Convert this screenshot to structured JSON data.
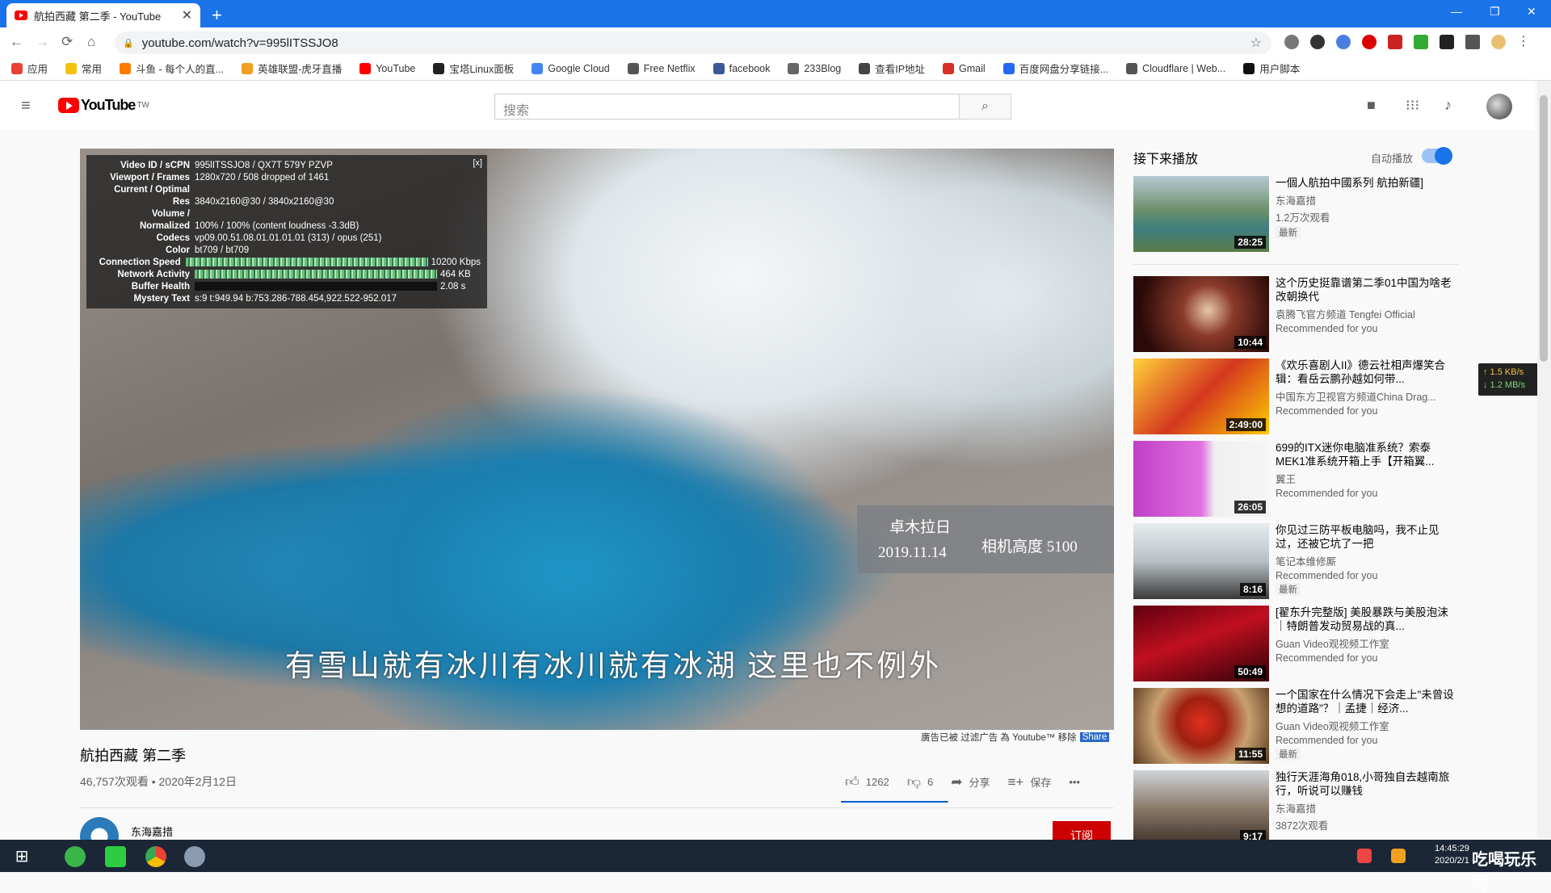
{
  "browser": {
    "tab_title": "航拍西藏 第二季 - YouTube",
    "tab_close": "✕",
    "new_tab": "+",
    "url": "youtube.com/watch?v=995lITSSJO8",
    "back": "←",
    "forward": "→",
    "reload": "⟳",
    "home": "⌂",
    "star": "☆",
    "minimize": "—",
    "restore": "❐",
    "close": "✕"
  },
  "bookmarks": [
    {
      "label": "应用",
      "color": "#e94235"
    },
    {
      "label": "常用",
      "color": "#f4c20d"
    },
    {
      "label": "斗鱼 - 每个人的直...",
      "color": "#ff7a00"
    },
    {
      "label": "英雄联盟-虎牙直播",
      "color": "#f0a020"
    },
    {
      "label": "YouTube",
      "color": "#ff0000"
    },
    {
      "label": "宝塔Linux面板",
      "color": "#222222"
    },
    {
      "label": "Google Cloud",
      "color": "#4285f4"
    },
    {
      "label": "Free Netflix",
      "color": "#555555"
    },
    {
      "label": "facebook",
      "color": "#3b5998"
    },
    {
      "label": "233Blog",
      "color": "#666666"
    },
    {
      "label": "查看IP地址",
      "color": "#444444"
    },
    {
      "label": "Gmail",
      "color": "#d93025"
    },
    {
      "label": "百度网盘分享链接...",
      "color": "#2468f2"
    },
    {
      "label": "Cloudflare | Web...",
      "color": "#555555"
    },
    {
      "label": "用户脚本",
      "color": "#111111"
    }
  ],
  "youtube": {
    "logo": "YouTube",
    "logo_region": "TW",
    "search_placeholder": "搜索",
    "search_icon": "⌕",
    "menu_icon": "≡"
  },
  "stats": {
    "close": "[x]",
    "rows": [
      {
        "label": "Video ID / sCPN",
        "value": "995lITSSJO8 / QX7T 579Y PZVP"
      },
      {
        "label": "Viewport / Frames",
        "value": "1280x720 / 508 dropped of 1461"
      },
      {
        "label": "Current / Optimal",
        "value": ""
      },
      {
        "label": "Res",
        "value": "3840x2160@30 / 3840x2160@30"
      },
      {
        "label": "Volume /",
        "value": ""
      },
      {
        "label": "Normalized",
        "value": "100% / 100% (content loudness -3.3dB)"
      },
      {
        "label": "Codecs",
        "value": "vp09.00.51.08.01.01.01.01 (313) / opus (251)"
      },
      {
        "label": "Color",
        "value": "bt709 / bt709"
      },
      {
        "label": "Connection Speed",
        "value": "10200 Kbps"
      },
      {
        "label": "Network Activity",
        "value": "464 KB"
      },
      {
        "label": "Buffer Health",
        "value": "2.08 s"
      },
      {
        "label": "Mystery Text",
        "value": "s:9 t:949.94 b:753.286-788.454,922.522-952.017"
      }
    ]
  },
  "overlay": {
    "place": "卓木拉日",
    "date": "2019.11.14",
    "altitude": "相机高度 5100",
    "subtitle": "有雪山就有冰川有冰川就有冰湖  这里也不例外"
  },
  "ad_note": {
    "text": "廣告已被 过滤广告 為 Youtube™ 移除",
    "share": "Share"
  },
  "video": {
    "title": "航拍西藏 第二季",
    "meta": "46,757次观看 • 2020年2月12日",
    "likes": "1262",
    "dislikes": "6",
    "share": "分享",
    "save": "保存",
    "more": "•••",
    "like_ratio": 0.995
  },
  "channel": {
    "name": "东海嘉措",
    "subscribe": "订阅"
  },
  "upnext": {
    "heading": "接下来播放",
    "autoplay": "自动播放",
    "autoplay_on": true
  },
  "sidebar": [
    {
      "title": "一個人航拍中國系列 航拍新疆]",
      "channel": "东海嘉措",
      "views": "1.2万次观看",
      "badge": "最新",
      "duration": "28:25",
      "thumb": "linear-gradient(180deg,#b7c9d3 0%,#6c8f6c 45%,#3f7e7e 70%,#5a7a4a 100%)"
    },
    {
      "title": "这个历史挺靠谱第二季01中国为啥老改朝换代",
      "channel": "袁腾飞官方频道 Tengfei Official",
      "views": "Recommended for you",
      "badge": "",
      "duration": "10:44",
      "thumb": "radial-gradient(circle at 55% 45%,#e8c8a8 0%,#8a3a2a 30%,#2a0a08 80%)"
    },
    {
      "title": "《欢乐喜剧人II》德云社相声爆笑合辑：看岳云鹏孙越如何带...",
      "channel": "中国东方卫视官方频道China Drag...",
      "views": "Recommended for you",
      "badge": "",
      "duration": "2:49:00",
      "thumb": "linear-gradient(135deg,#ffd23a 0%,#d4381e 50%,#ffcc00 100%)"
    },
    {
      "title": "699的ITX迷你电脑准系统？索泰MEK1准系统开箱上手【开箱翼...",
      "channel": "翼王",
      "views": "Recommended for you",
      "badge": "",
      "duration": "26:05",
      "thumb": "linear-gradient(90deg,#c040c8 0%,#e070e0 50%,#f0f0f0 60%,#f5f5f5 100%)"
    },
    {
      "title": "你见过三防平板电脑吗，我不止见过，还被它坑了一把",
      "channel": "笔记本维修厮",
      "views": "Recommended for you",
      "badge": "最新",
      "duration": "8:16",
      "thumb": "linear-gradient(180deg,#e8ecef 0%,#b8c0c5 50%,#3a3a3a 100%)"
    },
    {
      "title": "[翟东升完整版] 美股暴跌与美股泡沫｜特朗普发动贸易战的真...",
      "channel": "Guan Video观视频工作室",
      "views": "Recommended for you",
      "badge": "",
      "duration": "50:49",
      "thumb": "linear-gradient(160deg,#600010 0%,#c01020 45%,#300008 100%)"
    },
    {
      "title": "一个国家在什么情况下会走上\"未曾设想的道路\"？｜孟捷｜经济...",
      "channel": "Guan Video观视频工作室",
      "views": "Recommended for you",
      "badge": "最新",
      "duration": "11:55",
      "thumb": "radial-gradient(circle at 50% 45%,#e03020 0%,#a02010 30%,#c8a070 60%,#5a3a20 100%)"
    },
    {
      "title": "独行天涯海角018,小哥独自去越南旅行，听说可以赚钱",
      "channel": "东海嘉措",
      "views": "3872次观看",
      "badge": "",
      "duration": "9:17",
      "thumb": "linear-gradient(180deg,#d0d4d8 0%,#8a7a6a 50%,#3a2e26 100%)"
    }
  ],
  "netspeed": {
    "up": "↑ 1.5 KB/s",
    "down": "↓ 1.2 MB/s"
  },
  "taskbar": {
    "time": "14:45:29",
    "date": "2020/2/1",
    "brand": "吃喝玩乐网"
  }
}
